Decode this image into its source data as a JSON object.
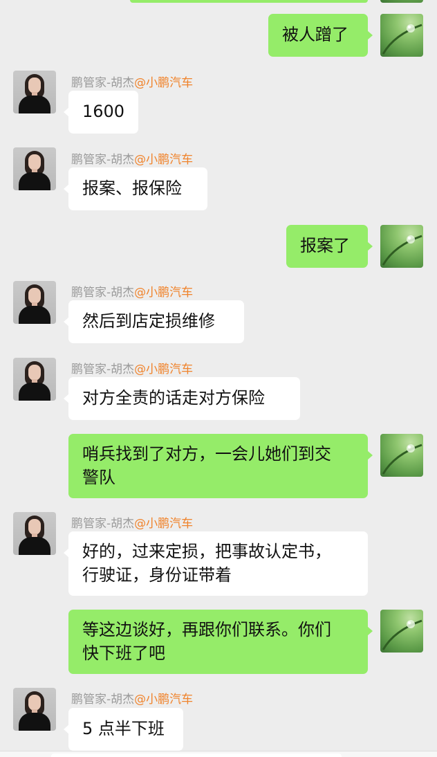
{
  "agent": {
    "name": "鹏管家-胡杰",
    "company": "@小鹏汽车"
  },
  "messages": [
    {
      "from": "self",
      "text": "被人蹭了"
    },
    {
      "from": "agent",
      "text": "1600"
    },
    {
      "from": "agent",
      "text": "报案、报保险"
    },
    {
      "from": "self",
      "text": "报案了"
    },
    {
      "from": "agent",
      "text": "然后到店定损维修"
    },
    {
      "from": "agent",
      "text": "对方全责的话走对方保险"
    },
    {
      "from": "self",
      "lines": [
        "哨兵找到了对方，一会儿她们到交",
        "警队"
      ]
    },
    {
      "from": "agent",
      "lines": [
        "好的，过来定损，把事故认定书，",
        "行驶证，身份证带着"
      ]
    },
    {
      "from": "self",
      "lines": [
        "等这边谈好，再跟你们联系。你们",
        "快下班了吧"
      ]
    },
    {
      "from": "agent",
      "text": "5 点半下班"
    }
  ],
  "colors": {
    "background": "#ededed",
    "outgoing_bubble": "#95ec69",
    "incoming_bubble": "#ffffff",
    "company_accent": "#f0832b"
  },
  "icons": {
    "agent_avatar": "woman-portrait-avatar",
    "self_avatar": "green-leaf-dewdrop-avatar"
  }
}
